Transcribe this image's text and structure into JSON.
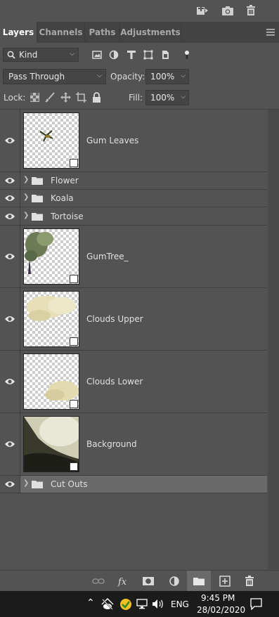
{
  "tabs": [
    {
      "label": "Layers",
      "active": true
    },
    {
      "label": "Channels",
      "active": false
    },
    {
      "label": "Paths",
      "active": false
    },
    {
      "label": "Adjustments",
      "active": false
    }
  ],
  "filter": {
    "kind_label": "Kind"
  },
  "blend": {
    "mode": "Pass Through",
    "opacity_label": "Opacity:",
    "opacity_value": "100%"
  },
  "lock": {
    "label": "Lock:",
    "fill_label": "Fill:",
    "fill_value": "100%"
  },
  "layers": [
    {
      "type": "layer",
      "name": "Gum Leaves",
      "visible": true,
      "smart_object": true
    },
    {
      "type": "group",
      "name": "Flower",
      "visible": true
    },
    {
      "type": "group",
      "name": "Koala",
      "visible": true
    },
    {
      "type": "group",
      "name": "Tortoise",
      "visible": true
    },
    {
      "type": "layer",
      "name": "GumTree_",
      "visible": true,
      "smart_object": true
    },
    {
      "type": "layer",
      "name": "Clouds Upper",
      "visible": true,
      "smart_object": true
    },
    {
      "type": "layer",
      "name": "Clouds Lower",
      "visible": true,
      "smart_object": true
    },
    {
      "type": "layer",
      "name": "Background",
      "visible": true,
      "smart_object": true
    },
    {
      "type": "group",
      "name": "Cut Outs",
      "visible": true,
      "selected": true
    }
  ],
  "taskbar": {
    "language": "ENG",
    "time": "9:45 PM",
    "date": "28/02/2020"
  },
  "colors": {
    "panel": "#535353",
    "tab_bar": "#434343",
    "selected_row": "#6a6a6a",
    "taskbar": "#1b1b1b"
  }
}
